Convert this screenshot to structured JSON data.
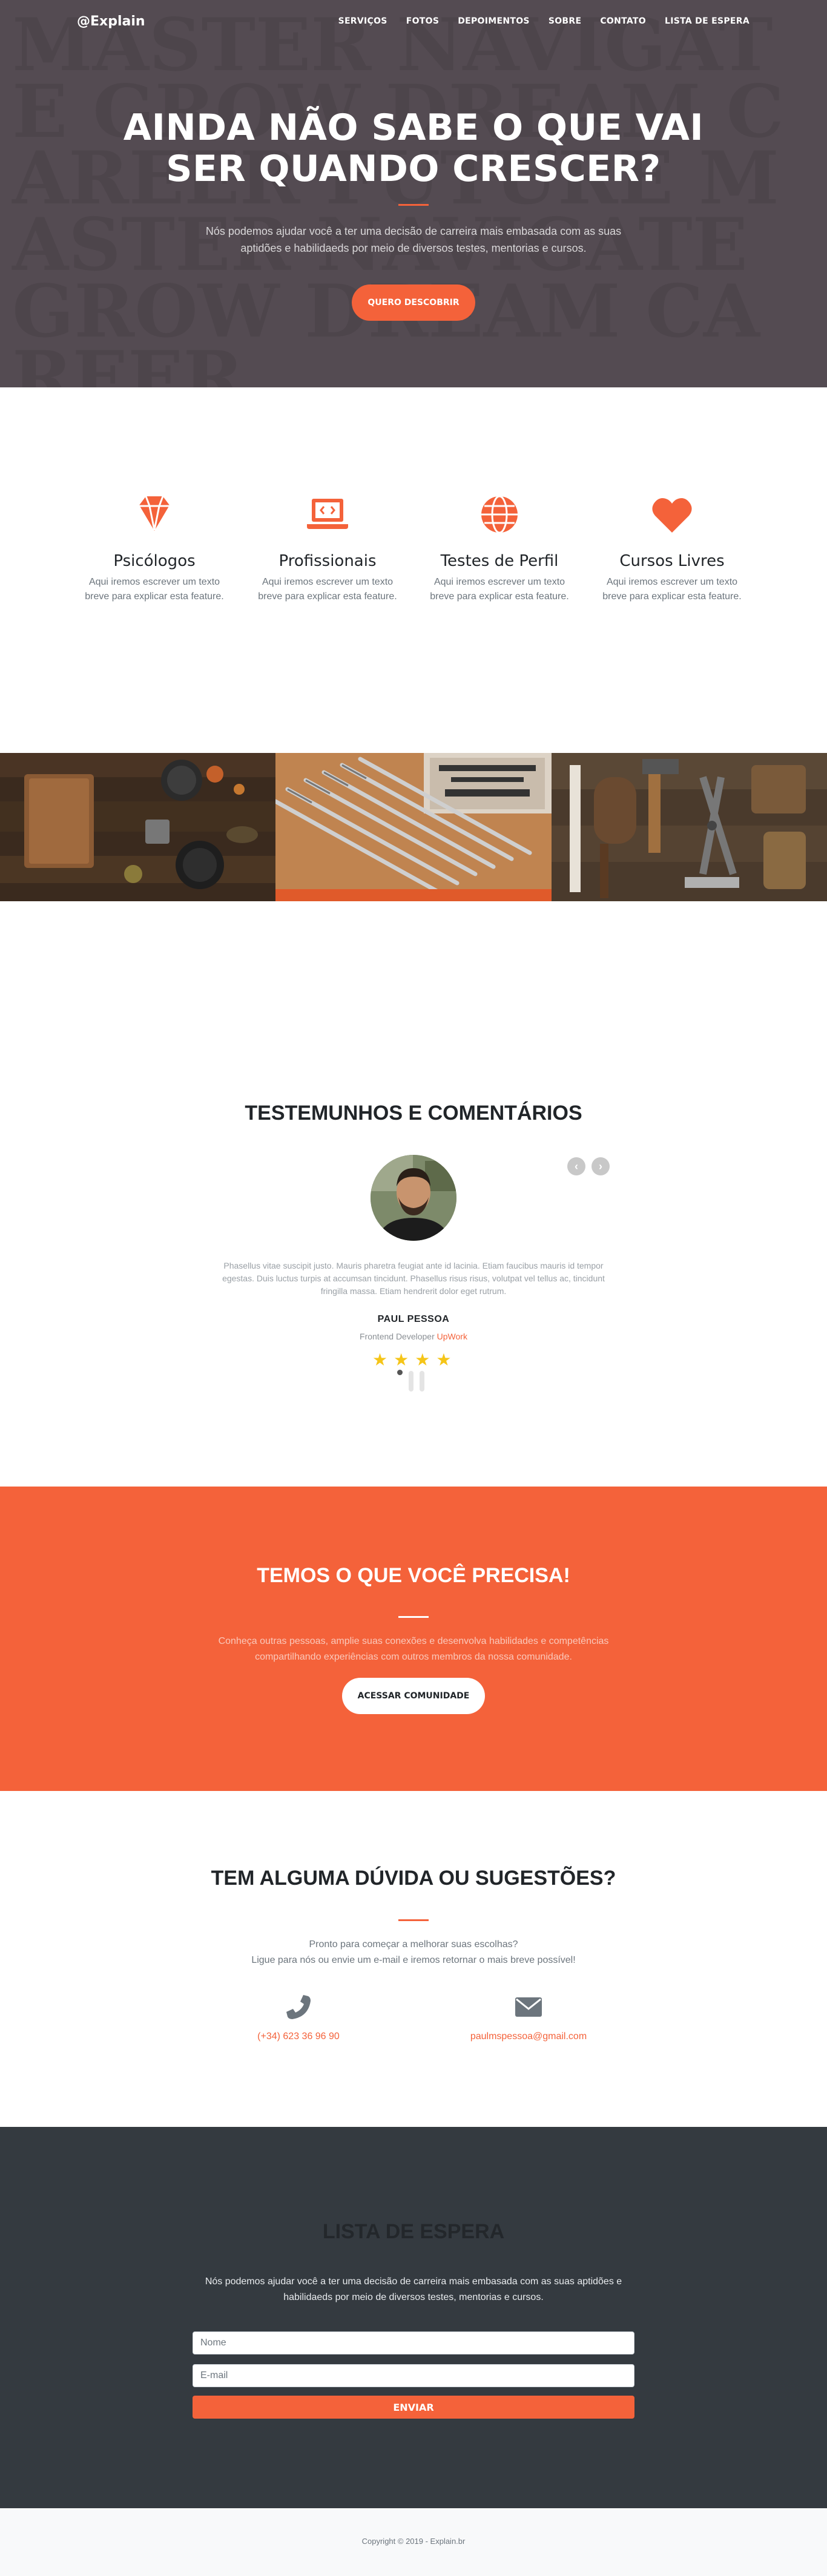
{
  "nav": {
    "brand": "@Explain",
    "items": [
      "SERVIÇOS",
      "FOTOS",
      "DEPOIMENTOS",
      "SOBRE",
      "CONTATO",
      "LISTA DE ESPERA"
    ]
  },
  "hero": {
    "title_line1": "AINDA NÃO SABE O QUE VAI",
    "title_line2": "SER QUANDO CRESCER?",
    "text": "Nós podemos ajudar você a ter uma decisão de carreira mais embasada com as suas aptidões e habilidaeds por meio de diversos testes, mentorias e cursos.",
    "button": "QUERO DESCOBRIR"
  },
  "services": [
    {
      "icon": "gem-icon",
      "title": "Psicólogos",
      "text": "Aqui iremos escrever um texto breve para explicar esta feature."
    },
    {
      "icon": "laptop-code-icon",
      "title": "Profissionais",
      "text": "Aqui iremos escrever um texto breve para explicar esta feature."
    },
    {
      "icon": "globe-icon",
      "title": "Testes de Perfil",
      "text": "Aqui iremos escrever um texto breve para explicar esta feature."
    },
    {
      "icon": "heart-icon",
      "title": "Cursos Livres",
      "text": "Aqui iremos escrever um texto breve para explicar esta feature."
    }
  ],
  "testimonials": {
    "title": "TESTEMUNHOS E COMENTÁRIOS",
    "quote": "Phasellus vitae suscipit justo. Mauris pharetra feugiat ante id lacinia. Etiam faucibus mauris id tempor egestas. Duis luctus turpis at accumsan tincidunt. Phasellus risus risus, volutpat vel tellus ac, tincidunt fringilla massa. Etiam hendrerit dolor eget rutrum.",
    "name": "PAUL PESSOA",
    "role_prefix": "Frontend Developer ",
    "company": "UpWork",
    "rating": 4,
    "prev_icon": "‹",
    "next_icon": "›"
  },
  "cta": {
    "title": "TEMOS O QUE VOCÊ PRECISA!",
    "text": "Conheça outras pessoas, amplie suas conexões e desenvolva habilidades e competências compartilhando experiências com outros membros da nossa comunidade.",
    "button": "ACESSAR COMUNIDADE"
  },
  "contact": {
    "title": "TEM ALGUMA DÚVIDA OU SUGESTÕES?",
    "line1": "Pronto para começar a melhorar suas escolhas?",
    "line2": "Ligue para nós ou envie um e-mail e iremos retornar o mais breve possível!",
    "phone": "(+34) 623 36 96 90",
    "email": "paulmspessoa@gmail.com"
  },
  "waitlist": {
    "title": "LISTA DE ESPERA",
    "text": "Nós podemos ajudar você a ter uma decisão de carreira mais embasada com as suas aptidões e habilidaeds por meio de diversos testes, mentorias e cursos.",
    "name_placeholder": "Nome",
    "email_placeholder": "E-mail",
    "button": "ENVIAR"
  },
  "footer": {
    "copyright": "Copyright © 2019 - Explain.br"
  },
  "colors": {
    "accent": "#f4623a",
    "dark": "#343a40",
    "hero": "#544b52"
  }
}
